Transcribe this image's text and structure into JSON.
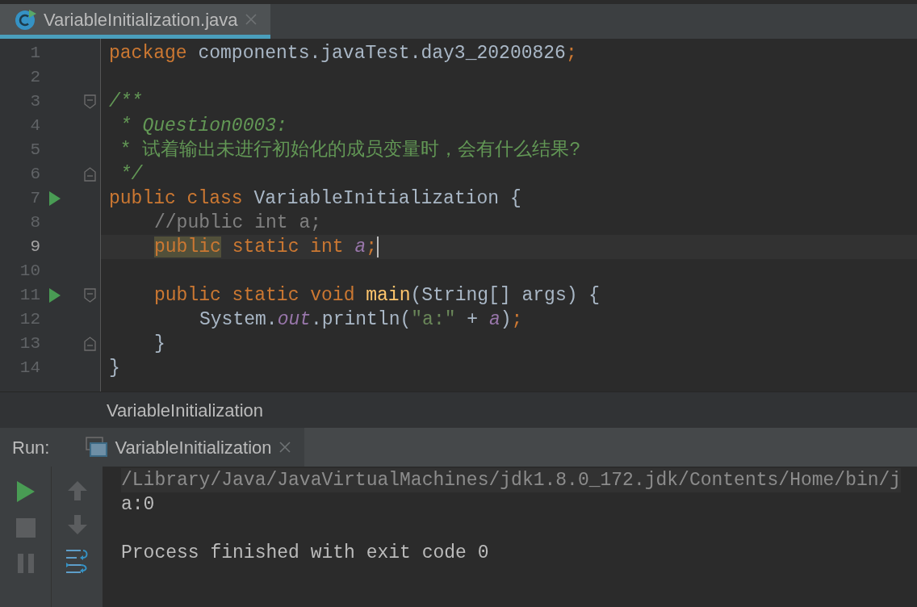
{
  "editor_tabs": [
    {
      "label": "VariableInitialization.java",
      "selected": true
    }
  ],
  "code_lines": [
    {
      "number": "1",
      "run_marker": false,
      "fold_start": false,
      "fold_end": false,
      "current": false,
      "tokens": [
        {
          "kind": "keyword",
          "text": "package "
        },
        {
          "kind": "plain",
          "text": "components.javaTest.day3_20200826"
        },
        {
          "kind": "keyword",
          "text": ";"
        }
      ]
    },
    {
      "number": "2",
      "run_marker": false,
      "fold_start": false,
      "fold_end": false,
      "current": false
    },
    {
      "number": "3",
      "run_marker": false,
      "fold_start": true,
      "fold_end": false,
      "current": false,
      "tokens": [
        {
          "kind": "doc",
          "text": "/**"
        }
      ]
    },
    {
      "number": "4",
      "run_marker": false,
      "fold_start": false,
      "fold_end": false,
      "current": false,
      "tokens": [
        {
          "kind": "doc",
          "text": " * Question0003:"
        }
      ]
    },
    {
      "number": "5",
      "run_marker": false,
      "fold_start": false,
      "fold_end": false,
      "current": false,
      "tokens": [
        {
          "kind": "doc",
          "text": " * 试着输出未进行初始化的成员变量时，会有什么结果?"
        }
      ]
    },
    {
      "number": "6",
      "run_marker": false,
      "fold_start": false,
      "fold_end": true,
      "current": false,
      "tokens": [
        {
          "kind": "doc",
          "text": " */"
        }
      ]
    },
    {
      "number": "7",
      "run_marker": true,
      "fold_start": false,
      "fold_end": false,
      "current": false,
      "tokens": [
        {
          "kind": "keyword",
          "text": "public class "
        },
        {
          "kind": "plain",
          "text": "VariableInitialization {"
        }
      ],
      "children": [
        {
          "number": "8",
          "run_marker": false,
          "fold_start": false,
          "fold_end": false,
          "current": false,
          "tokens": [
            {
              "kind": "comment",
              "text": "//public int a;"
            }
          ]
        },
        {
          "number": "9",
          "run_marker": false,
          "fold_start": false,
          "fold_end": false,
          "current": true,
          "tokens": [
            {
              "kind": "keyword",
              "text": "public",
              "highlighted": true
            },
            {
              "kind": "keyword",
              "text": " static int "
            },
            {
              "kind": "field",
              "text": "a"
            },
            {
              "kind": "keyword",
              "text": ";"
            }
          ]
        },
        {
          "number": "10",
          "run_marker": false,
          "fold_start": false,
          "fold_end": false,
          "current": false
        },
        {
          "number": "11",
          "run_marker": true,
          "fold_start": true,
          "fold_end": false,
          "current": false,
          "tokens": [
            {
              "kind": "keyword",
              "text": "public static void "
            },
            {
              "kind": "method",
              "text": "main"
            },
            {
              "kind": "plain",
              "text": "(String[] args) {"
            }
          ],
          "children": [
            {
              "number": "12",
              "run_marker": false,
              "fold_start": false,
              "fold_end": false,
              "current": false,
              "tokens": [
                {
                  "kind": "plain",
                  "text": "System."
                },
                {
                  "kind": "field",
                  "text": "out"
                },
                {
                  "kind": "plain",
                  "text": ".println("
                },
                {
                  "kind": "string",
                  "text": "\"a:\""
                },
                {
                  "kind": "plain",
                  "text": " + "
                },
                {
                  "kind": "field",
                  "text": "a"
                },
                {
                  "kind": "plain",
                  "text": ")"
                },
                {
                  "kind": "keyword",
                  "text": ";"
                }
              ]
            }
          ]
        },
        {
          "number": "13",
          "run_marker": false,
          "fold_start": false,
          "fold_end": true,
          "current": false,
          "tokens": [
            {
              "kind": "plain",
              "text": "}"
            }
          ]
        }
      ]
    },
    {
      "number": "14",
      "run_marker": false,
      "fold_start": false,
      "fold_end": false,
      "current": false,
      "tokens": [
        {
          "kind": "plain",
          "text": "}"
        }
      ]
    }
  ],
  "breadcrumb": "VariableInitialization",
  "run_panel": {
    "label": "Run:",
    "tabs": [
      {
        "label": "VariableInitialization",
        "selected": true
      }
    ],
    "console_lines": [
      {
        "kind": "command",
        "text": "/Library/Java/JavaVirtualMachines/jdk1.8.0_172.jdk/Contents/Home/bin/j"
      },
      {
        "kind": "output",
        "text": "a:0"
      },
      {
        "kind": "blank"
      },
      {
        "kind": "output",
        "text": "Process finished with exit code 0"
      }
    ]
  }
}
